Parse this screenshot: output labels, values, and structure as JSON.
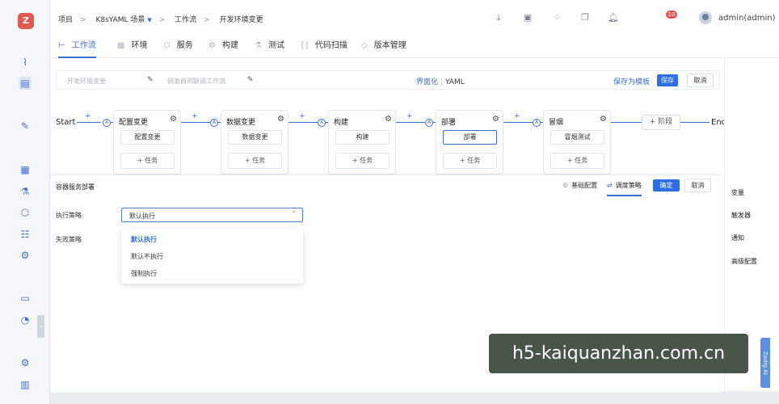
{
  "breadcrumb": [
    "项目",
    "K8sYAML 场景",
    "工作流",
    "开发环境变更"
  ],
  "breadcrumb_separator": ">",
  "header": {
    "notification_count": "10",
    "username": "admin(admin)"
  },
  "tabs": [
    {
      "label": "工作流",
      "icon": "workflow-icon",
      "active": true
    },
    {
      "label": "环境",
      "icon": "environment-icon"
    },
    {
      "label": "服务",
      "icon": "service-icon"
    },
    {
      "label": "构建",
      "icon": "build-icon"
    },
    {
      "label": "测试",
      "icon": "test-icon"
    },
    {
      "label": "代码扫描",
      "icon": "code-scan-icon"
    },
    {
      "label": "版本管理",
      "icon": "version-icon"
    }
  ],
  "editor": {
    "name_placeholder": "开发环境变更",
    "desc_placeholder": "研发自测联调工作流",
    "mode_ui": "界面化",
    "mode_yaml": "YAML",
    "save_template": "保存为模板",
    "save": "保存",
    "cancel": "取消"
  },
  "flow": {
    "start": "Start",
    "end": "End",
    "plus": "+",
    "node": "A",
    "add_stage": "+ 阶段",
    "add_task": "+ 任务",
    "stages": [
      {
        "name": "配置变更",
        "job": "配置变更"
      },
      {
        "name": "数据变更",
        "job": "数据变更"
      },
      {
        "name": "构建",
        "job": "构建"
      },
      {
        "name": "部署",
        "job": "部署",
        "selected": true
      },
      {
        "name": "冒烟",
        "job": "冒烟测试"
      }
    ]
  },
  "panel": {
    "title": "容器服务部署",
    "tab_basic": "基础配置",
    "tab_schedule": "调度策略",
    "confirm": "确定",
    "cancel": "取消",
    "exec_strategy_label": "执行策略",
    "fail_strategy_label": "失败策略",
    "exec_strategy_value": "默认执行",
    "options": [
      "默认执行",
      "默认不执行",
      "强制执行"
    ]
  },
  "right_rail": [
    "变量",
    "触发器",
    "通知",
    "高级配置"
  ],
  "ai_assistant": "Zadig AI",
  "watermark": "h5-kaiquanzhan.com.cn",
  "colors": {
    "primary": "#2f6fe6",
    "badge": "#f05252",
    "logo": "#e05a4f"
  }
}
